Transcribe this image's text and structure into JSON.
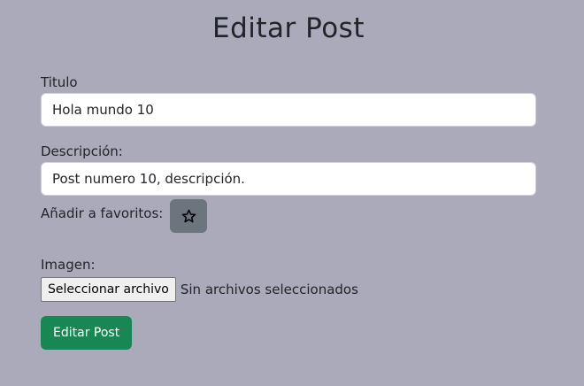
{
  "page": {
    "title": "Editar Post"
  },
  "form": {
    "title_label": "Titulo",
    "title_value": "Hola mundo 10",
    "description_label": "Descripción:",
    "description_value": "Post numero 10, descripción.",
    "favorite_label": "Añadir a favoritos:",
    "favorite_icon": "star-outline-icon",
    "image_label": "Imagen:",
    "file_button_label": "Seleccionar archivo",
    "file_status": "Sin archivos seleccionados",
    "submit_label": "Editar Post"
  },
  "colors": {
    "background": "#aaaaba",
    "favorite_button": "#6c757d",
    "submit_button": "#198754"
  }
}
